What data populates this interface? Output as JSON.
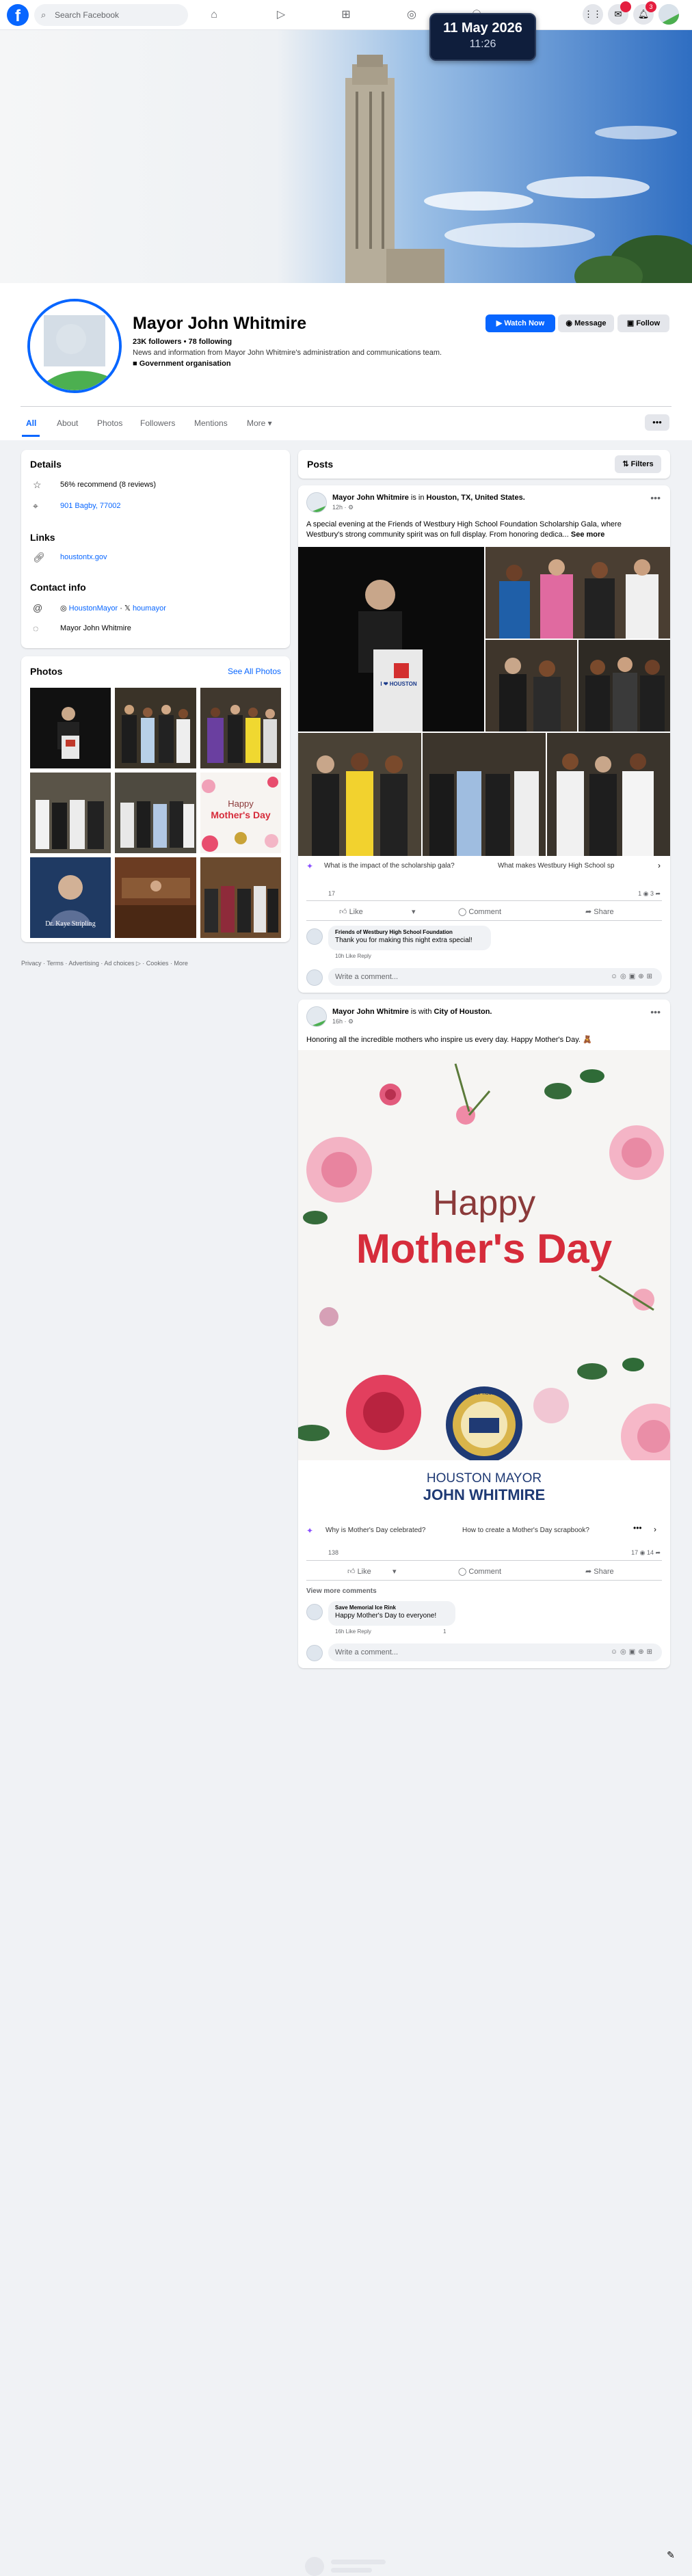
{
  "topbar": {
    "logo": "f",
    "search_placeholder": "Search Facebook",
    "nav_icons": [
      "home-icon",
      "video-icon",
      "marketplace-icon",
      "groups-icon",
      "gaming-icon"
    ],
    "notification_badge": "3",
    "messenger_badge": ""
  },
  "clock": {
    "date": "11 May 2026",
    "time": "11:26"
  },
  "profile": {
    "name": "Mayor John Whitmire",
    "stats": "23K followers • 78 following",
    "description": "News and information from Mayor John Whitmire's administration and communications team.",
    "category": "Government organisation",
    "buttons": {
      "watch": "Watch Now",
      "message": "Message",
      "follow": "Follow"
    },
    "tabs": [
      "All",
      "About",
      "Photos",
      "Followers",
      "Mentions",
      "More ▾"
    ],
    "more_icon": "•••"
  },
  "details": {
    "title": "Details",
    "recommend": "56% recommend (8 reviews)",
    "address": "901 Bagby, 77002",
    "links_title": "Links",
    "website": "houstontx.gov",
    "contact_title": "Contact info",
    "instagram": "HoustonMayor",
    "threads": "houmayor",
    "messenger": "Mayor John Whitmire"
  },
  "photos": {
    "title": "Photos",
    "see_all": "See All Photos",
    "tile_text_mothers_top": "Happy",
    "tile_text_mothers": "Mother's Day",
    "tile_text_kaye": "Dr. Kaye Stripling",
    "tile_text_i_love": "I ❤ HOUSTON"
  },
  "footer": "Privacy · Terms · Advertising · Ad choices ▷ · Cookies · More",
  "posts_header": {
    "title": "Posts",
    "filters": "Filters"
  },
  "post1": {
    "author": "Mayor John Whitmire",
    "connector": " is in ",
    "place": "Houston, TX, United States.",
    "time": "12h · ⚙",
    "text": "A special evening at the Friends of Westbury High School Foundation Scholarship Gala, where Westbury's strong community spirit was on full display. From honoring dedica...",
    "see_more": "See more",
    "sign_text": "I ❤ HOUSTON",
    "ai_prompts": [
      "What is the impact of the scholarship gala?",
      "What makes Westbury High School sp"
    ],
    "reactions": "17",
    "counts": "1  ◉  3  ➦",
    "actions": [
      "Like",
      "Comment",
      "Share"
    ],
    "comment_author": "Friends of Westbury High School Foundation",
    "comment_text": "Thank you for making this night extra special!",
    "comment_meta": "10h   Like   Reply",
    "comment_placeholder": "Write a comment..."
  },
  "post2": {
    "author": "Mayor John Whitmire",
    "connector": " is with ",
    "with": "City of Houston.",
    "time": "16h · ⚙",
    "text": "Honoring all the incredible mothers who inspire us every day. Happy Mother's Day. 🧸",
    "image_happy": "Happy",
    "image_mothers_day": "Mother's Day",
    "image_seal_text": "CITY OF HOUSTON",
    "image_banner_line1": "HOUSTON MAYOR",
    "image_banner_line2": "JOHN WHITMIRE",
    "ai_prompts": [
      "Why is Mother's Day celebrated?",
      "How to create a Mother's Day scrapbook?"
    ],
    "reactions": "138",
    "counts": "17  ◉   14  ➦",
    "actions": [
      "Like",
      "Comment",
      "Share"
    ],
    "view_more": "View more comments",
    "comment_author": "Save Memorial Ice Rink",
    "comment_text": "Happy Mother's Day to everyone!",
    "comment_meta": "16h   Like   Reply",
    "comment_reaction": "1",
    "comment_placeholder": "Write a comment..."
  },
  "bottom_edit_icon": "✎"
}
